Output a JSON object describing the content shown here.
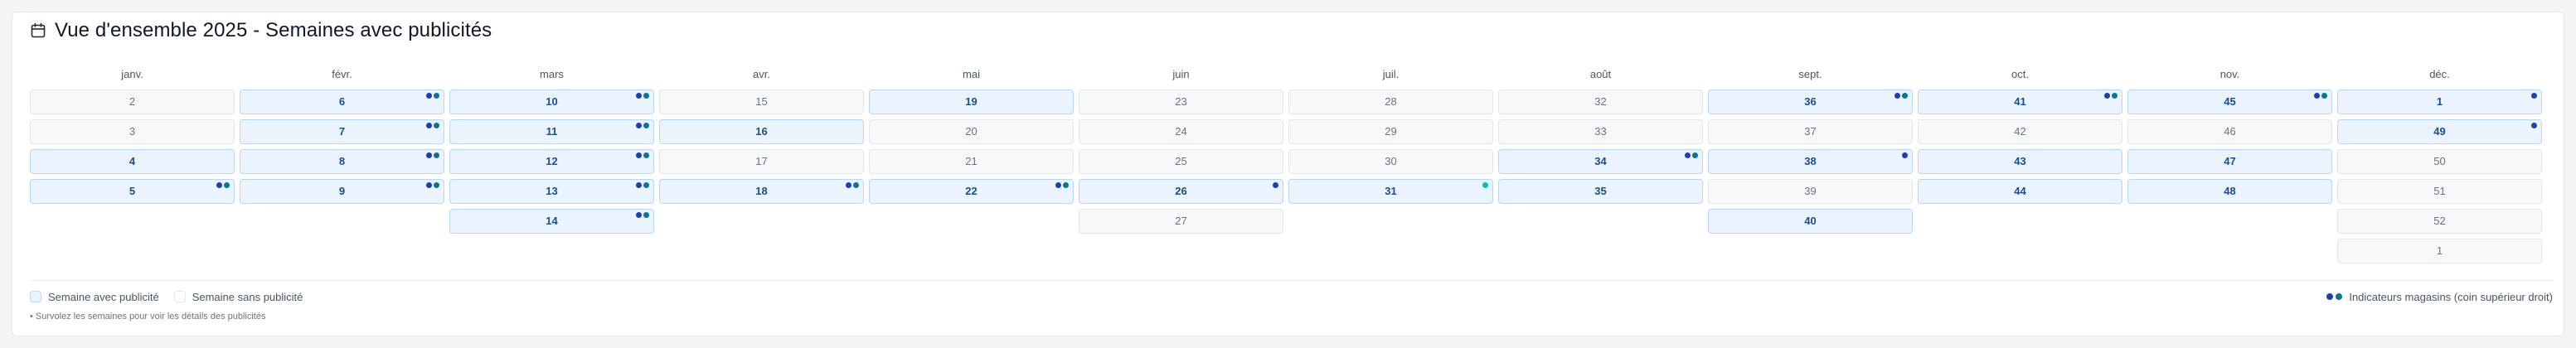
{
  "title": "Vue d'ensemble 2025 - Semaines avec publicités",
  "icon": "calendar-icon",
  "colors": {
    "ad_bg": "#eaf3fe",
    "ad_border": "#b8d6f6",
    "ad_text": "#1d4e89",
    "noad_bg": "#f7f8fa",
    "noad_border": "#e4e6ea",
    "dot_dark": "#1e40af",
    "dot_teal": "#0e7490",
    "dot_blue": "#2563eb",
    "dot_cyan": "#06b6d4"
  },
  "months": [
    {
      "label": "janv.",
      "weeks": [
        {
          "n": "2",
          "ad": false,
          "dots": 0
        },
        {
          "n": "3",
          "ad": false,
          "dots": 0
        },
        {
          "n": "4",
          "ad": true,
          "dots": 0
        },
        {
          "n": "5",
          "ad": true,
          "dots": 2
        }
      ]
    },
    {
      "label": "févr.",
      "weeks": [
        {
          "n": "6",
          "ad": true,
          "dots": 2
        },
        {
          "n": "7",
          "ad": true,
          "dots": 2
        },
        {
          "n": "8",
          "ad": true,
          "dots": 2
        },
        {
          "n": "9",
          "ad": true,
          "dots": 2
        }
      ]
    },
    {
      "label": "mars",
      "weeks": [
        {
          "n": "10",
          "ad": true,
          "dots": 2
        },
        {
          "n": "11",
          "ad": true,
          "dots": 2
        },
        {
          "n": "12",
          "ad": true,
          "dots": 2
        },
        {
          "n": "13",
          "ad": true,
          "dots": 2
        },
        {
          "n": "14",
          "ad": true,
          "dots": 2
        }
      ]
    },
    {
      "label": "avr.",
      "weeks": [
        {
          "n": "15",
          "ad": false,
          "dots": 0
        },
        {
          "n": "16",
          "ad": true,
          "dots": 0
        },
        {
          "n": "17",
          "ad": false,
          "dots": 0
        },
        {
          "n": "18",
          "ad": true,
          "dots": 2
        }
      ]
    },
    {
      "label": "mai",
      "weeks": [
        {
          "n": "19",
          "ad": true,
          "dots": 0
        },
        {
          "n": "20",
          "ad": false,
          "dots": 0
        },
        {
          "n": "21",
          "ad": false,
          "dots": 0
        },
        {
          "n": "22",
          "ad": true,
          "dots": 2
        }
      ]
    },
    {
      "label": "juin",
      "weeks": [
        {
          "n": "23",
          "ad": false,
          "dots": 0
        },
        {
          "n": "24",
          "ad": false,
          "dots": 0
        },
        {
          "n": "25",
          "ad": false,
          "dots": 0
        },
        {
          "n": "26",
          "ad": true,
          "dots": 1
        },
        {
          "n": "27",
          "ad": false,
          "dots": 0
        }
      ]
    },
    {
      "label": "juil.",
      "weeks": [
        {
          "n": "28",
          "ad": false,
          "dots": 0
        },
        {
          "n": "29",
          "ad": false,
          "dots": 0
        },
        {
          "n": "30",
          "ad": false,
          "dots": 0
        },
        {
          "n": "31",
          "ad": true,
          "dots": 1,
          "dot_color": "teal"
        }
      ]
    },
    {
      "label": "août",
      "weeks": [
        {
          "n": "32",
          "ad": false,
          "dots": 0
        },
        {
          "n": "33",
          "ad": false,
          "dots": 0
        },
        {
          "n": "34",
          "ad": true,
          "dots": 2
        },
        {
          "n": "35",
          "ad": true,
          "dots": 0
        }
      ]
    },
    {
      "label": "sept.",
      "weeks": [
        {
          "n": "36",
          "ad": true,
          "dots": 2
        },
        {
          "n": "37",
          "ad": false,
          "dots": 0
        },
        {
          "n": "38",
          "ad": true,
          "dots": 1
        },
        {
          "n": "39",
          "ad": false,
          "dots": 0
        },
        {
          "n": "40",
          "ad": true,
          "dots": 0
        }
      ]
    },
    {
      "label": "oct.",
      "weeks": [
        {
          "n": "41",
          "ad": true,
          "dots": 2
        },
        {
          "n": "42",
          "ad": false,
          "dots": 0
        },
        {
          "n": "43",
          "ad": true,
          "dots": 0
        },
        {
          "n": "44",
          "ad": true,
          "dots": 0
        }
      ]
    },
    {
      "label": "nov.",
      "weeks": [
        {
          "n": "45",
          "ad": true,
          "dots": 2
        },
        {
          "n": "46",
          "ad": false,
          "dots": 0
        },
        {
          "n": "47",
          "ad": true,
          "dots": 0
        },
        {
          "n": "48",
          "ad": true,
          "dots": 0
        }
      ]
    },
    {
      "label": "déc.",
      "weeks": [
        {
          "n": "1",
          "ad": true,
          "dots": 1
        },
        {
          "n": "49",
          "ad": true,
          "dots": 1
        },
        {
          "n": "50",
          "ad": false,
          "dots": 0
        },
        {
          "n": "51",
          "ad": false,
          "dots": 0
        },
        {
          "n": "52",
          "ad": false,
          "dots": 0
        },
        {
          "n": "1",
          "ad": false,
          "dots": 0
        }
      ]
    }
  ],
  "legend": {
    "with_ad": "Semaine avec publicité",
    "without_ad": "Semaine sans publicité",
    "store_indicators": "Indicateurs magasins (coin supérieur droit)"
  },
  "hint": "• Survolez les semaines pour voir les détails des publicités"
}
